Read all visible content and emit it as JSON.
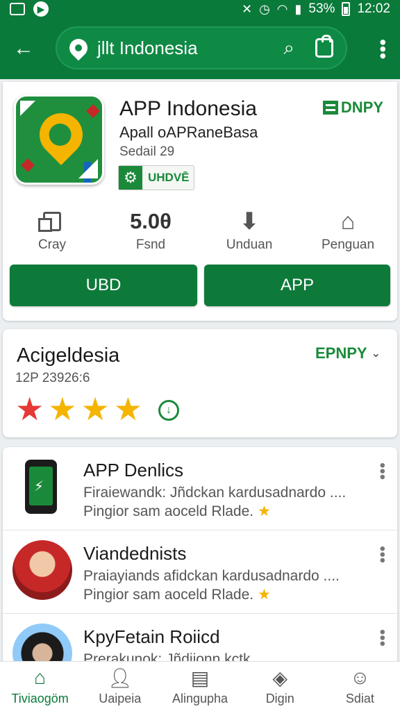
{
  "status_bar": {
    "battery": "53%",
    "time": "12:02"
  },
  "search": {
    "query": "jllt Indonesia"
  },
  "app": {
    "title": "APP Indonesia",
    "subtitle": "Apall oAPRaneBasa",
    "meta": "Sedail 29",
    "badge_label": "UHDVĒ",
    "brand": "DNPY"
  },
  "stats": [
    {
      "icon": "copy-icon",
      "value": "",
      "label": "Cray"
    },
    {
      "icon": "",
      "value": "5.0θ",
      "label": "Fsnd"
    },
    {
      "icon": "download-icon",
      "value": "",
      "label": "Unduan"
    },
    {
      "icon": "house-icon",
      "value": "",
      "label": "Penguan"
    }
  ],
  "buttons": {
    "left": "UBD",
    "right": "APP"
  },
  "rating": {
    "title": "Acigeldesia",
    "meta": "12P 23926:6",
    "brand": "EPNPY",
    "stars": 4
  },
  "list": [
    {
      "title": "APP Denlics",
      "desc": "Firaiewandk: Jñdckan kardusadnardo ....",
      "desc2": "Pingior sam aoceld Rlade.",
      "thumb": "phone-icon"
    },
    {
      "title": "Viandednists",
      "desc": "Praiayiands afidckan kardusadnardo ....",
      "desc2": "Pingior sam aoceld Rlade.",
      "thumb": "avatar"
    },
    {
      "title": "KpyFetain Roiicd",
      "desc": "Prerakunok: Jñdiionn kctk ...",
      "desc2": "",
      "thumb": "avatar"
    }
  ],
  "bottom_nav": [
    {
      "label": "Tiviaogöm",
      "icon": "home-icon",
      "active": true
    },
    {
      "label": "Uaipeia",
      "icon": "person-icon",
      "active": false
    },
    {
      "label": "Alinguрha",
      "icon": "document-icon",
      "active": false
    },
    {
      "label": "Digin",
      "icon": "layers-icon",
      "active": false
    },
    {
      "label": "Sdiat",
      "icon": "account-icon",
      "active": false
    }
  ],
  "colors": {
    "primary": "#0a7a3a",
    "accent": "#f5b400",
    "danger": "#e53935"
  }
}
